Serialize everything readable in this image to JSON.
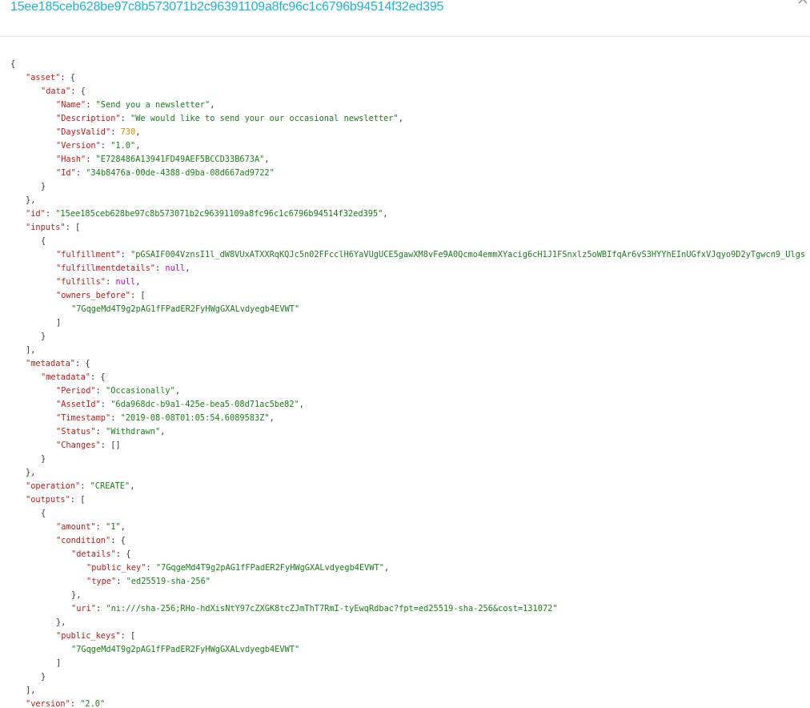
{
  "modal": {
    "title": "15ee185ceb628be97c8b573071b2c96391109a8fc96c1c6796b94514f32ed395",
    "close_icon": "close-icon"
  },
  "colors": {
    "title": "#1ab5d8",
    "key": "#c41a16",
    "string": "#1a7f1a",
    "number": "#e08a00",
    "null": "#c800c8"
  },
  "json_lines": [
    {
      "indent": 0,
      "parts": [
        {
          "t": "p",
          "v": "{"
        }
      ]
    },
    {
      "indent": 1,
      "parts": [
        {
          "t": "k",
          "v": "\"asset\""
        },
        {
          "t": "p",
          "v": ": {"
        }
      ]
    },
    {
      "indent": 2,
      "parts": [
        {
          "t": "k",
          "v": "\"data\""
        },
        {
          "t": "p",
          "v": ": {"
        }
      ]
    },
    {
      "indent": 3,
      "parts": [
        {
          "t": "k",
          "v": "\"Name\""
        },
        {
          "t": "p",
          "v": ": "
        },
        {
          "t": "s",
          "v": "\"Send you a newsletter\""
        },
        {
          "t": "p",
          "v": ","
        }
      ]
    },
    {
      "indent": 3,
      "parts": [
        {
          "t": "k",
          "v": "\"Description\""
        },
        {
          "t": "p",
          "v": ": "
        },
        {
          "t": "s",
          "v": "\"We would like to send your our occasional newsletter\""
        },
        {
          "t": "p",
          "v": ","
        }
      ]
    },
    {
      "indent": 3,
      "parts": [
        {
          "t": "k",
          "v": "\"DaysValid\""
        },
        {
          "t": "p",
          "v": ": "
        },
        {
          "t": "n",
          "v": "730"
        },
        {
          "t": "p",
          "v": ","
        }
      ]
    },
    {
      "indent": 3,
      "parts": [
        {
          "t": "k",
          "v": "\"Version\""
        },
        {
          "t": "p",
          "v": ": "
        },
        {
          "t": "s",
          "v": "\"1.0\""
        },
        {
          "t": "p",
          "v": ","
        }
      ]
    },
    {
      "indent": 3,
      "parts": [
        {
          "t": "k",
          "v": "\"Hash\""
        },
        {
          "t": "p",
          "v": ": "
        },
        {
          "t": "s",
          "v": "\"E728486A13941FD49AEF5BCCD33B673A\""
        },
        {
          "t": "p",
          "v": ","
        }
      ]
    },
    {
      "indent": 3,
      "parts": [
        {
          "t": "k",
          "v": "\"Id\""
        },
        {
          "t": "p",
          "v": ": "
        },
        {
          "t": "s",
          "v": "\"34b8476a-00de-4388-d9ba-08d667ad9722\""
        }
      ]
    },
    {
      "indent": 2,
      "parts": [
        {
          "t": "p",
          "v": "}"
        }
      ]
    },
    {
      "indent": 1,
      "parts": [
        {
          "t": "p",
          "v": "},"
        }
      ]
    },
    {
      "indent": 1,
      "parts": [
        {
          "t": "k",
          "v": "\"id\""
        },
        {
          "t": "p",
          "v": ": "
        },
        {
          "t": "s",
          "v": "\"15ee185ceb628be97c8b573071b2c96391109a8fc96c1c6796b94514f32ed395\""
        },
        {
          "t": "p",
          "v": ","
        }
      ]
    },
    {
      "indent": 1,
      "parts": [
        {
          "t": "k",
          "v": "\"inputs\""
        },
        {
          "t": "p",
          "v": ": ["
        }
      ]
    },
    {
      "indent": 2,
      "parts": [
        {
          "t": "p",
          "v": "{"
        }
      ]
    },
    {
      "indent": 3,
      "parts": [
        {
          "t": "k",
          "v": "\"fulfillment\""
        },
        {
          "t": "p",
          "v": ": "
        },
        {
          "t": "s",
          "v": "\"pGSAIF004VznsI1l_dW8VUxATXXRqKQJc5n02FFcclH6YaVUgUCE5gawXM8vFe9A0Qcmo4emmXYacig6cH1J1FSnxlz5oWBIfqAr6vS3HYYhEInUGfxVJqyo9D2yTgwcn9_Ulgs"
        }
      ]
    },
    {
      "indent": 3,
      "parts": [
        {
          "t": "k",
          "v": "\"fulfillmentdetails\""
        },
        {
          "t": "p",
          "v": ": "
        },
        {
          "t": "u",
          "v": "null"
        },
        {
          "t": "p",
          "v": ","
        }
      ]
    },
    {
      "indent": 3,
      "parts": [
        {
          "t": "k",
          "v": "\"fulfills\""
        },
        {
          "t": "p",
          "v": ": "
        },
        {
          "t": "u",
          "v": "null"
        },
        {
          "t": "p",
          "v": ","
        }
      ]
    },
    {
      "indent": 3,
      "parts": [
        {
          "t": "k",
          "v": "\"owners_before\""
        },
        {
          "t": "p",
          "v": ": ["
        }
      ]
    },
    {
      "indent": 4,
      "parts": [
        {
          "t": "s",
          "v": "\"7GqgeMd4T9g2pAG1fFPadER2FyHWgGXALvdyegb4EVWT\""
        }
      ]
    },
    {
      "indent": 3,
      "parts": [
        {
          "t": "p",
          "v": "]"
        }
      ]
    },
    {
      "indent": 2,
      "parts": [
        {
          "t": "p",
          "v": "}"
        }
      ]
    },
    {
      "indent": 1,
      "parts": [
        {
          "t": "p",
          "v": "],"
        }
      ]
    },
    {
      "indent": 1,
      "parts": [
        {
          "t": "k",
          "v": "\"metadata\""
        },
        {
          "t": "p",
          "v": ": {"
        }
      ]
    },
    {
      "indent": 2,
      "parts": [
        {
          "t": "k",
          "v": "\"metadata\""
        },
        {
          "t": "p",
          "v": ": {"
        }
      ]
    },
    {
      "indent": 3,
      "parts": [
        {
          "t": "k",
          "v": "\"Period\""
        },
        {
          "t": "p",
          "v": ": "
        },
        {
          "t": "s",
          "v": "\"Occasionally\""
        },
        {
          "t": "p",
          "v": ","
        }
      ]
    },
    {
      "indent": 3,
      "parts": [
        {
          "t": "k",
          "v": "\"AssetId\""
        },
        {
          "t": "p",
          "v": ": "
        },
        {
          "t": "s",
          "v": "\"6da968dc-b9a1-425e-bea5-08d71ac5be82\""
        },
        {
          "t": "p",
          "v": ","
        }
      ]
    },
    {
      "indent": 3,
      "parts": [
        {
          "t": "k",
          "v": "\"Timestamp\""
        },
        {
          "t": "p",
          "v": ": "
        },
        {
          "t": "s",
          "v": "\"2019-08-08T01:05:54.6089583Z\""
        },
        {
          "t": "p",
          "v": ","
        }
      ]
    },
    {
      "indent": 3,
      "parts": [
        {
          "t": "k",
          "v": "\"Status\""
        },
        {
          "t": "p",
          "v": ": "
        },
        {
          "t": "s",
          "v": "\"Withdrawn\""
        },
        {
          "t": "p",
          "v": ","
        }
      ]
    },
    {
      "indent": 3,
      "parts": [
        {
          "t": "k",
          "v": "\"Changes\""
        },
        {
          "t": "p",
          "v": ": []"
        }
      ]
    },
    {
      "indent": 2,
      "parts": [
        {
          "t": "p",
          "v": "}"
        }
      ]
    },
    {
      "indent": 1,
      "parts": [
        {
          "t": "p",
          "v": "},"
        }
      ]
    },
    {
      "indent": 1,
      "parts": [
        {
          "t": "k",
          "v": "\"operation\""
        },
        {
          "t": "p",
          "v": ": "
        },
        {
          "t": "s",
          "v": "\"CREATE\""
        },
        {
          "t": "p",
          "v": ","
        }
      ]
    },
    {
      "indent": 1,
      "parts": [
        {
          "t": "k",
          "v": "\"outputs\""
        },
        {
          "t": "p",
          "v": ": ["
        }
      ]
    },
    {
      "indent": 2,
      "parts": [
        {
          "t": "p",
          "v": "{"
        }
      ]
    },
    {
      "indent": 3,
      "parts": [
        {
          "t": "k",
          "v": "\"amount\""
        },
        {
          "t": "p",
          "v": ": "
        },
        {
          "t": "s",
          "v": "\"1\""
        },
        {
          "t": "p",
          "v": ","
        }
      ]
    },
    {
      "indent": 3,
      "parts": [
        {
          "t": "k",
          "v": "\"condition\""
        },
        {
          "t": "p",
          "v": ": {"
        }
      ]
    },
    {
      "indent": 4,
      "parts": [
        {
          "t": "k",
          "v": "\"details\""
        },
        {
          "t": "p",
          "v": ": {"
        }
      ]
    },
    {
      "indent": 5,
      "parts": [
        {
          "t": "k",
          "v": "\"public_key\""
        },
        {
          "t": "p",
          "v": ": "
        },
        {
          "t": "s",
          "v": "\"7GqgeMd4T9g2pAG1fFPadER2FyHWgGXALvdyegb4EVWT\""
        },
        {
          "t": "p",
          "v": ","
        }
      ]
    },
    {
      "indent": 5,
      "parts": [
        {
          "t": "k",
          "v": "\"type\""
        },
        {
          "t": "p",
          "v": ": "
        },
        {
          "t": "s",
          "v": "\"ed25519-sha-256\""
        }
      ]
    },
    {
      "indent": 4,
      "parts": [
        {
          "t": "p",
          "v": "},"
        }
      ]
    },
    {
      "indent": 4,
      "parts": [
        {
          "t": "k",
          "v": "\"uri\""
        },
        {
          "t": "p",
          "v": ": "
        },
        {
          "t": "s",
          "v": "\"ni:///sha-256;RHo-hdXisNtY97cZXGK8tcZJmThT7RmI-tyEwqRdbac?fpt=ed25519-sha-256&cost=131072\""
        }
      ]
    },
    {
      "indent": 3,
      "parts": [
        {
          "t": "p",
          "v": "},"
        }
      ]
    },
    {
      "indent": 3,
      "parts": [
        {
          "t": "k",
          "v": "\"public_keys\""
        },
        {
          "t": "p",
          "v": ": ["
        }
      ]
    },
    {
      "indent": 4,
      "parts": [
        {
          "t": "s",
          "v": "\"7GqgeMd4T9g2pAG1fFPadER2FyHWgGXALvdyegb4EVWT\""
        }
      ]
    },
    {
      "indent": 3,
      "parts": [
        {
          "t": "p",
          "v": "]"
        }
      ]
    },
    {
      "indent": 2,
      "parts": [
        {
          "t": "p",
          "v": "}"
        }
      ]
    },
    {
      "indent": 1,
      "parts": [
        {
          "t": "p",
          "v": "],"
        }
      ]
    },
    {
      "indent": 1,
      "parts": [
        {
          "t": "k",
          "v": "\"version\""
        },
        {
          "t": "p",
          "v": ": "
        },
        {
          "t": "s",
          "v": "\"2.0\""
        }
      ]
    }
  ]
}
